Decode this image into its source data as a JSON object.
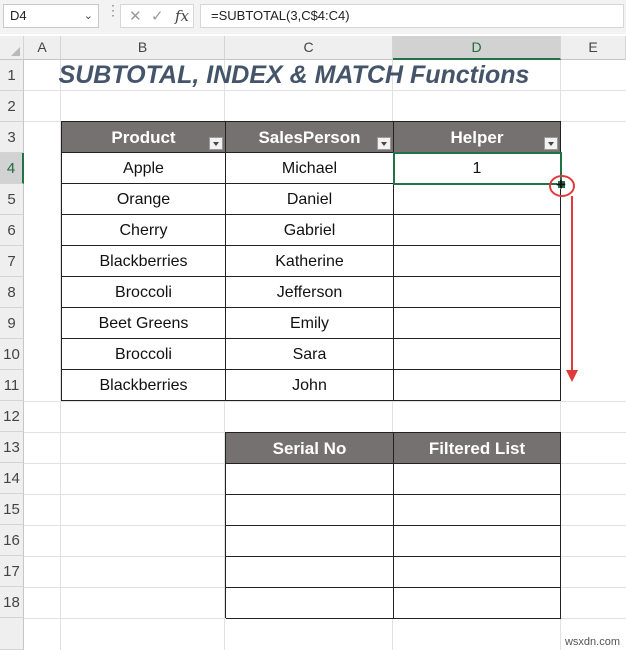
{
  "formula_bar": {
    "name_box": "D4",
    "cancel_icon": "cancel-icon",
    "enter_icon": "enter-icon",
    "fx_label": "fx",
    "formula": "=SUBTOTAL(3,C$4:C4)"
  },
  "columns": [
    "A",
    "B",
    "C",
    "D",
    "E"
  ],
  "rows": [
    "1",
    "2",
    "3",
    "4",
    "5",
    "6",
    "7",
    "8",
    "9",
    "10",
    "11",
    "12",
    "13",
    "14",
    "15",
    "16",
    "17",
    "18"
  ],
  "title": "SUBTOTAL, INDEX & MATCH Functions",
  "main_table": {
    "headers": [
      "Product",
      "SalesPerson",
      "Helper"
    ],
    "rows": [
      [
        "Apple",
        "Michael",
        "1"
      ],
      [
        "Orange",
        "Daniel",
        ""
      ],
      [
        "Cherry",
        "Gabriel",
        ""
      ],
      [
        "Blackberries",
        "Katherine",
        ""
      ],
      [
        "Broccoli",
        "Jefferson",
        ""
      ],
      [
        "Beet Greens",
        "Emily",
        ""
      ],
      [
        "Broccoli",
        "Sara",
        ""
      ],
      [
        "Blackberries",
        "John",
        ""
      ]
    ]
  },
  "filtered_table": {
    "headers": [
      "Serial No",
      "Filtered List"
    ]
  },
  "watermark": "wsxdn.com",
  "colors": {
    "header_fill": "#767171",
    "title": "#44546a",
    "selection": "#217346",
    "annotation": "#e03a3a"
  }
}
